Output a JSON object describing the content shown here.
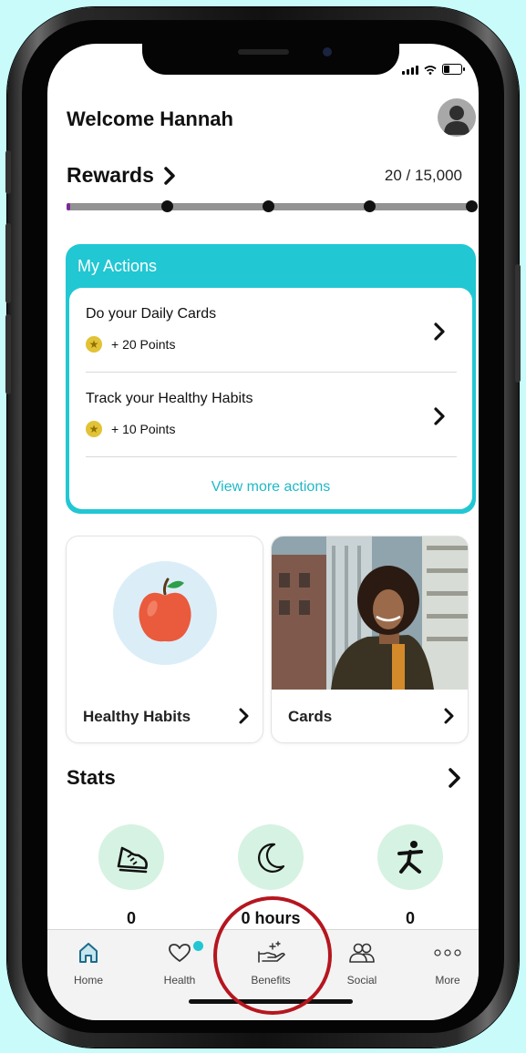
{
  "header": {
    "welcome": "Welcome Hannah"
  },
  "rewards": {
    "label": "Rewards",
    "value": "20 / 15,000",
    "progress_fraction": 0.0013
  },
  "my_actions": {
    "title": "My Actions",
    "items": [
      {
        "title": "Do your Daily Cards",
        "points": "+ 20 Points"
      },
      {
        "title": "Track your Healthy Habits",
        "points": "+ 10 Points"
      }
    ],
    "view_more": "View more actions"
  },
  "tiles": [
    {
      "label": "Healthy Habits"
    },
    {
      "label": "Cards"
    }
  ],
  "stats": {
    "title": "Stats",
    "items": [
      {
        "icon": "shoe-icon",
        "value": "0"
      },
      {
        "icon": "moon-icon",
        "value": "0 hours"
      },
      {
        "icon": "activity-icon",
        "value": "0"
      }
    ]
  },
  "tabbar": {
    "items": [
      {
        "label": "Home",
        "icon": "home-icon"
      },
      {
        "label": "Health",
        "icon": "heart-icon"
      },
      {
        "label": "Benefits",
        "icon": "benefits-hand-icon"
      },
      {
        "label": "Social",
        "icon": "people-icon"
      },
      {
        "label": "More",
        "icon": "more-dots-icon"
      }
    ]
  },
  "colors": {
    "accent": "#21c7d3",
    "progress": "#7a2a9a",
    "highlight_ring": "#b5161f",
    "background": "#c9fbfb"
  }
}
